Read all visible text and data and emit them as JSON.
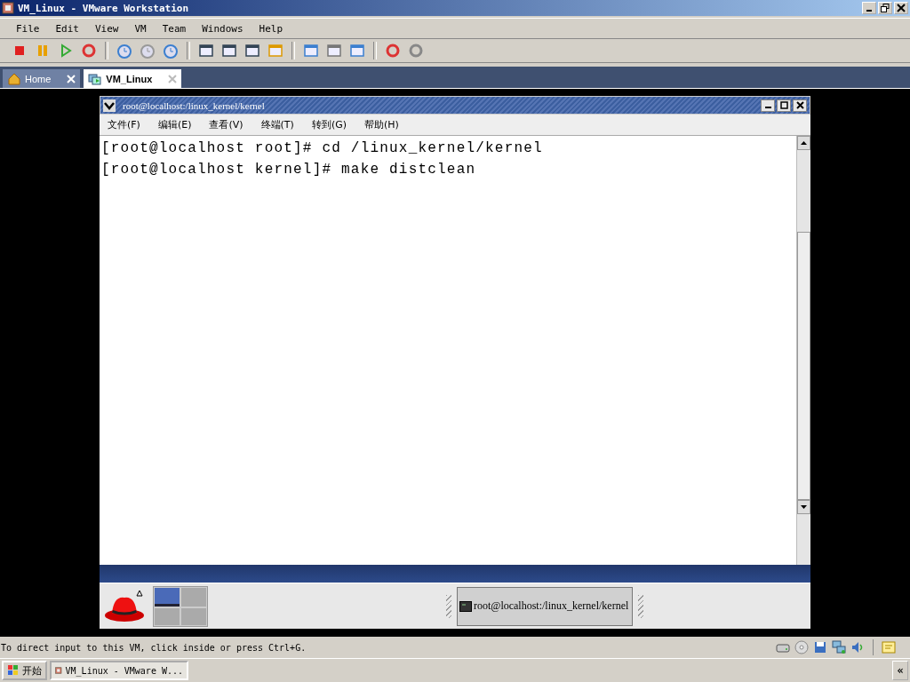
{
  "window": {
    "title": "VM_Linux - VMware Workstation"
  },
  "menu": [
    "File",
    "Edit",
    "View",
    "VM",
    "Team",
    "Windows",
    "Help"
  ],
  "tabs": [
    {
      "label": "Home",
      "kind": "home",
      "selected": false
    },
    {
      "label": "VM_Linux",
      "kind": "vm",
      "selected": true
    }
  ],
  "guest": {
    "title": "root@localhost:/linux_kernel/kernel",
    "menu": [
      "文件(F)",
      "编辑(E)",
      "查看(V)",
      "终端(T)",
      "转到(G)",
      "帮助(H)"
    ],
    "terminal_lines": [
      "[root@localhost root]# cd /linux_kernel/kernel",
      "[root@localhost kernel]# make distclean"
    ],
    "panel_task": "root@localhost:/linux_kernel/kernel"
  },
  "status_bar": "To direct input to this VM, click inside or press Ctrl+G.",
  "taskbar": {
    "start": "开始",
    "items": [
      "VM_Linux - VMware W..."
    ],
    "collapse": "«"
  }
}
